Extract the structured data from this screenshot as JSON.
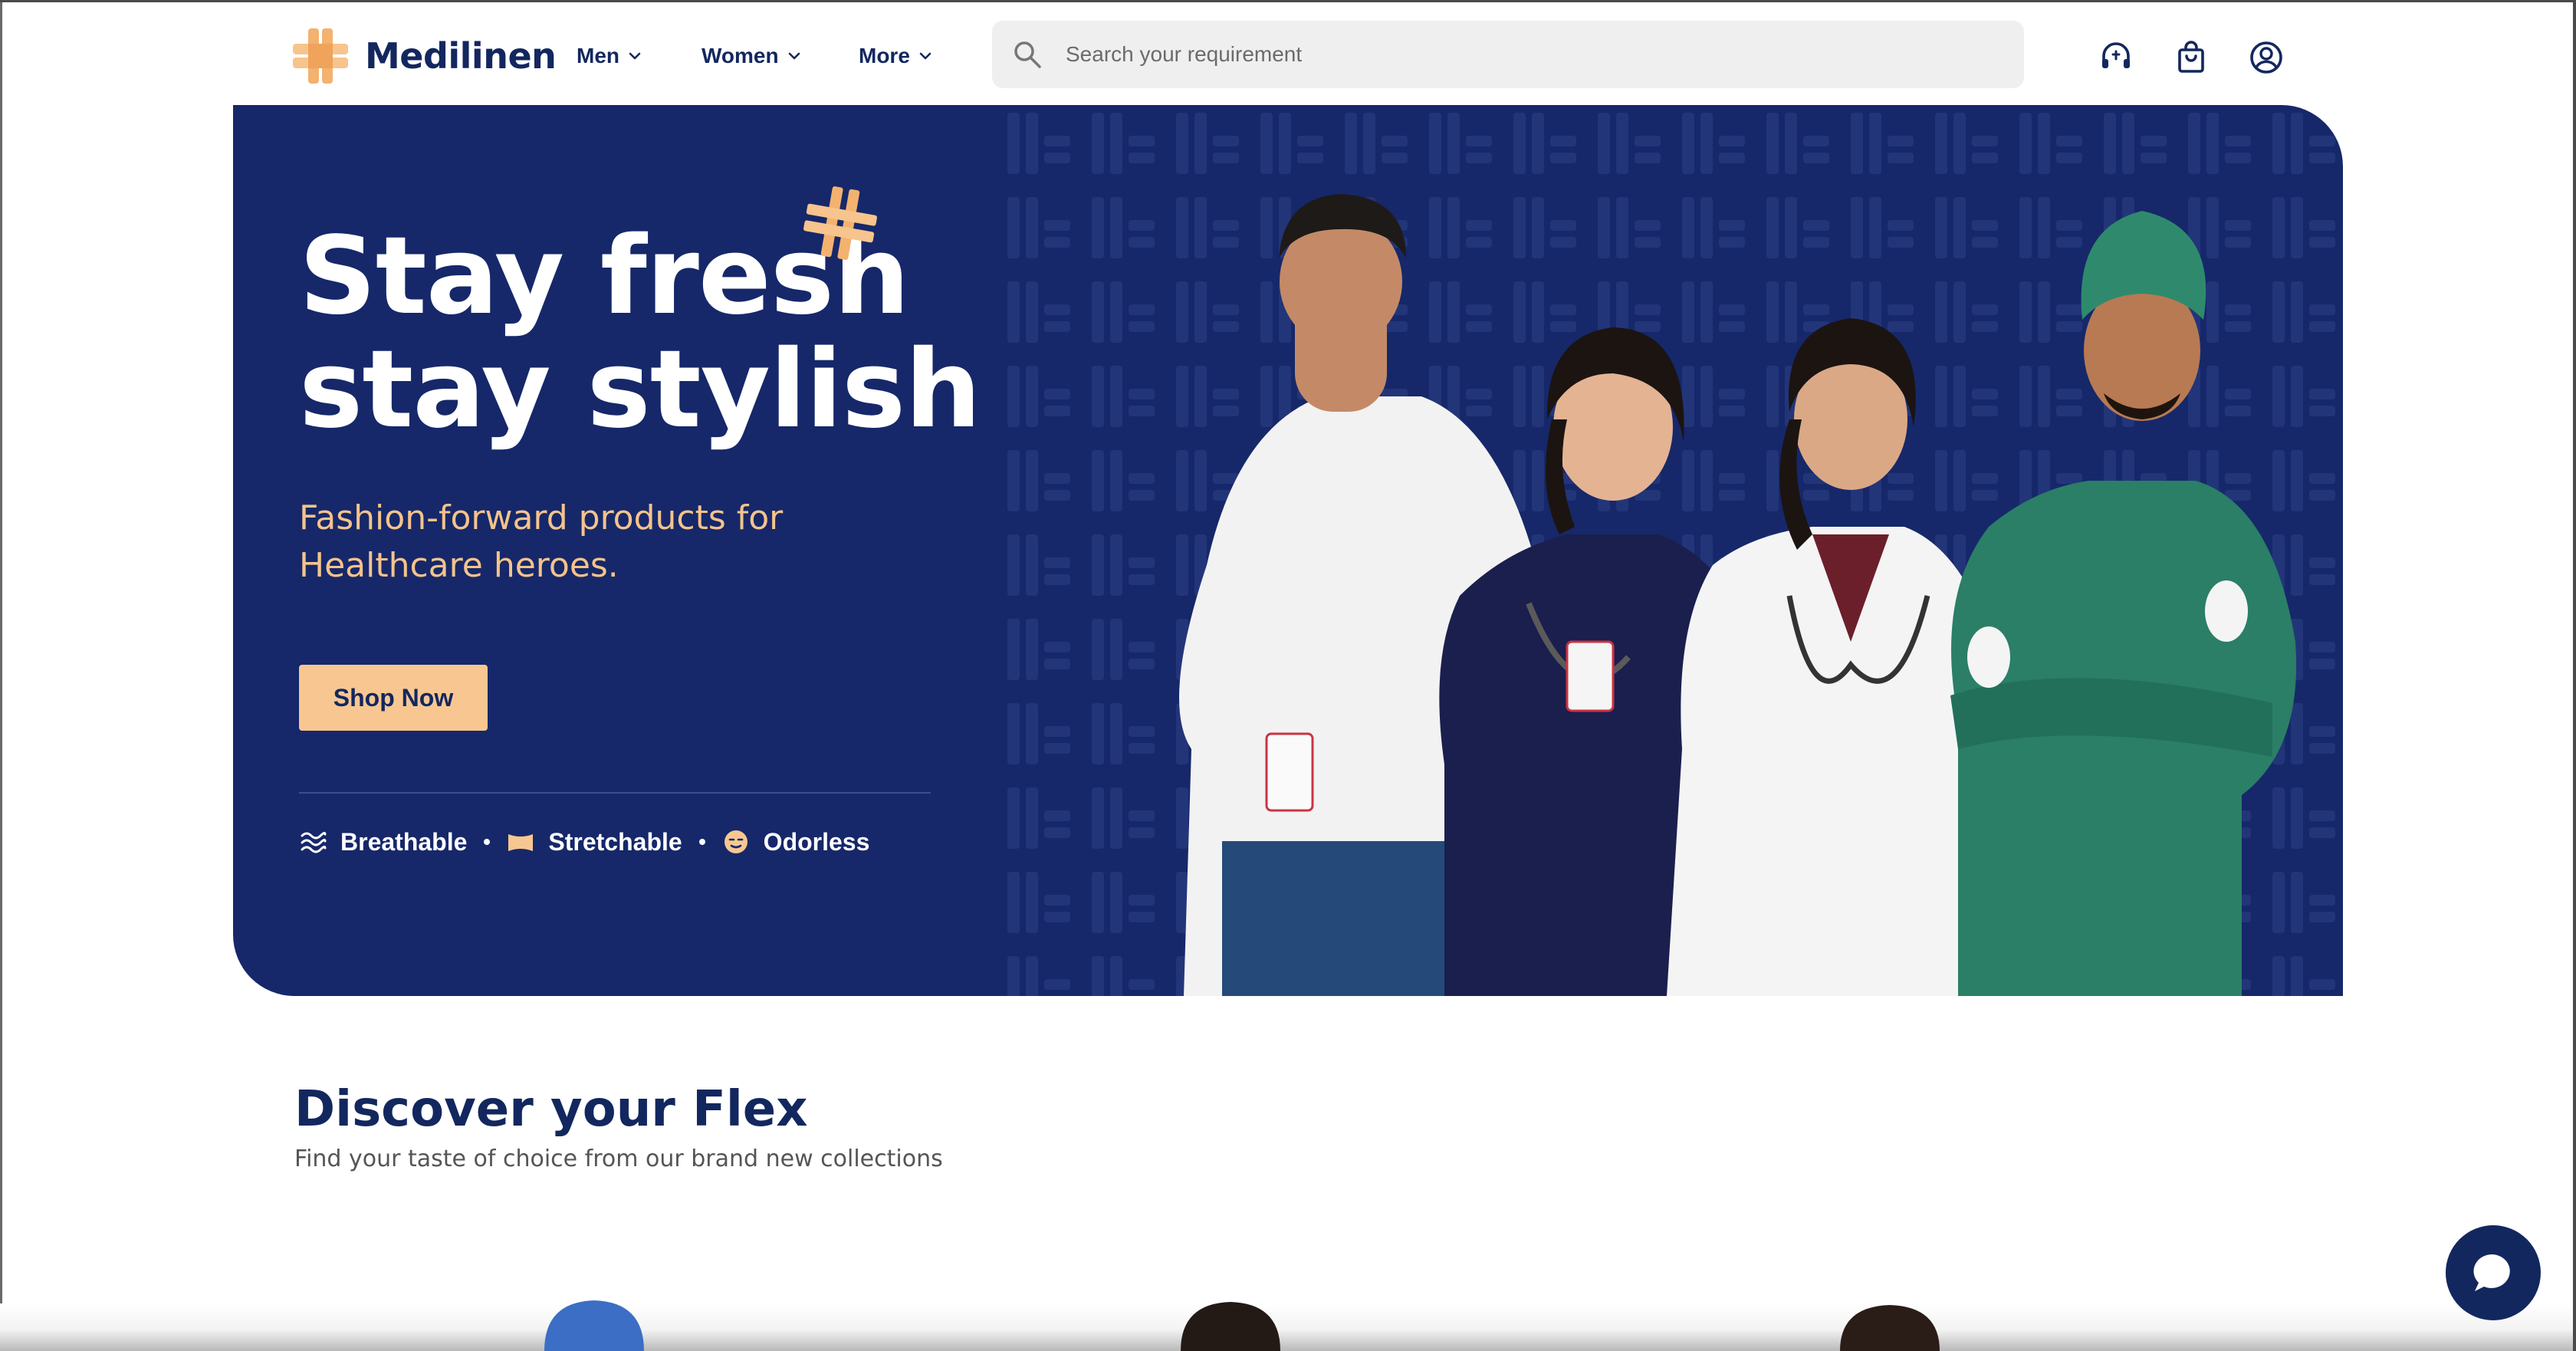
{
  "brand": {
    "name": "Medilinen",
    "accent_color": "#f8c791",
    "primary_color": "#16286a"
  },
  "nav": {
    "items": [
      {
        "label": "Men",
        "icon": "chevron-down-icon"
      },
      {
        "label": "Women",
        "icon": "chevron-down-icon"
      },
      {
        "label": "More",
        "icon": "chevron-down-icon"
      }
    ],
    "search_placeholder": "Search your requirement",
    "icons": [
      "support-icon",
      "shopping-bag-icon",
      "account-icon"
    ]
  },
  "hero": {
    "title_line1": "Stay fresh",
    "title_line2": "stay stylish",
    "subtitle_line1": "Fashion-forward products for",
    "subtitle_line2": "Healthcare heroes.",
    "cta_label": "Shop Now",
    "features": [
      {
        "label": "Breathable",
        "icon": "waves-icon"
      },
      {
        "label": "Stretchable",
        "icon": "fabric-icon"
      },
      {
        "label": "Odorless",
        "icon": "smiley-icon"
      }
    ]
  },
  "discover": {
    "title": "Discover your Flex",
    "subtitle": "Find your taste of choice from our brand new collections"
  },
  "chat": {
    "icon": "chat-bubble-icon"
  }
}
